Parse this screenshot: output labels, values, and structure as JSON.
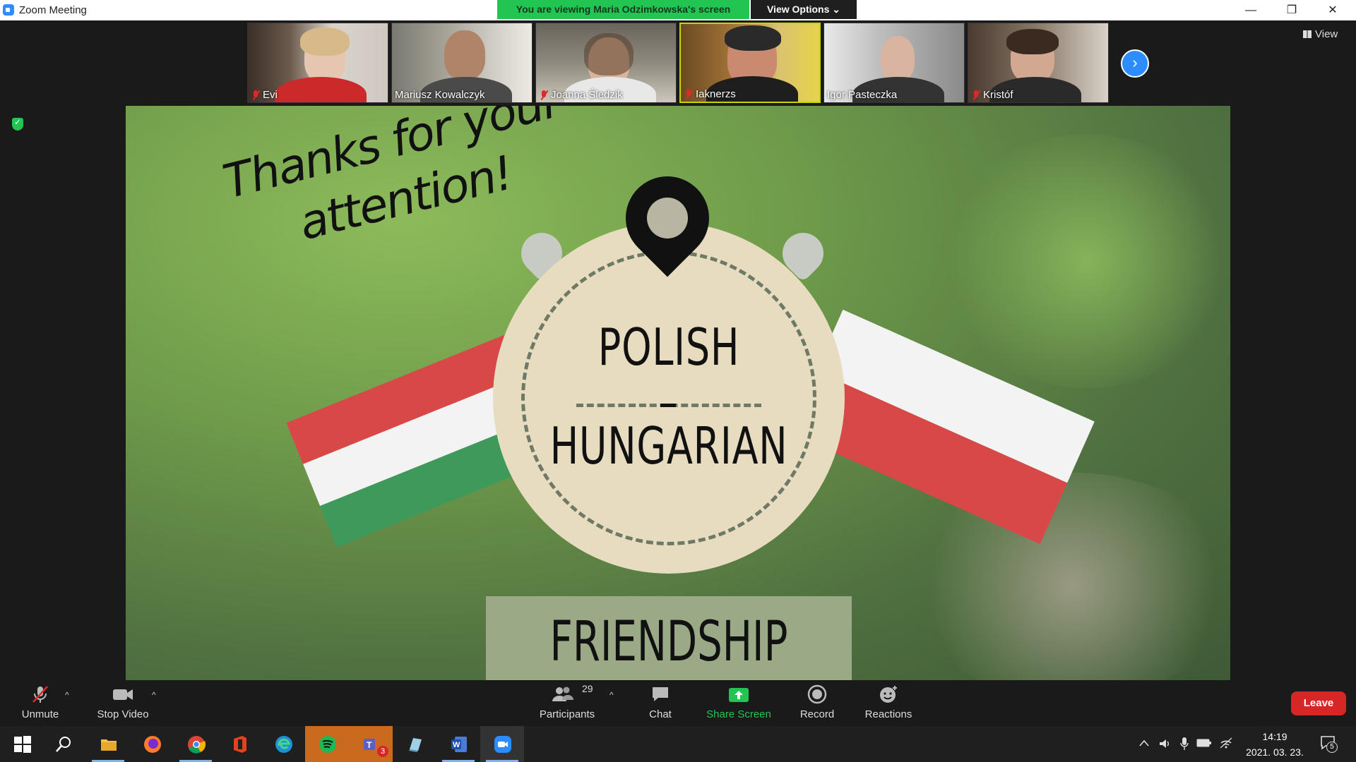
{
  "window": {
    "title": "Zoom Meeting",
    "banner": "You are viewing Maria Odzimkowska's screen",
    "view_options": "View Options ⌄",
    "minimize": "—",
    "restore": "❐",
    "close": "✕"
  },
  "gallery": {
    "participants": [
      {
        "name": "Evi",
        "muted": true
      },
      {
        "name": "Mariusz Kowalczyk",
        "muted": false
      },
      {
        "name": "Joanna Śledzik",
        "muted": true
      },
      {
        "name": "Iaknerzs",
        "muted": true
      },
      {
        "name": "Igor Pasteczka",
        "muted": false
      },
      {
        "name": "Kristóf",
        "muted": true
      }
    ],
    "next_label": "›",
    "view_label": "View"
  },
  "slide": {
    "thanks_line1": "Thanks for your",
    "thanks_line2": "attention!",
    "polish": "POLISH",
    "hungarian": "HUNGARIAN",
    "friendship": "FRIENDSHIP DAY",
    "colors": {
      "red": "#d94848",
      "white": "#f3f3f3",
      "green": "#3e9a5a",
      "beige": "#e8dcc0"
    }
  },
  "controls": {
    "unmute": "Unmute",
    "stop_video": "Stop Video",
    "participants": "Participants",
    "participants_count": "29",
    "chat": "Chat",
    "share_screen": "Share Screen",
    "record": "Record",
    "reactions": "Reactions",
    "leave": "Leave"
  },
  "taskbar": {
    "time": "14:19",
    "date": "2021. 03. 23.",
    "teams_badge": "3",
    "notifications": "5"
  }
}
